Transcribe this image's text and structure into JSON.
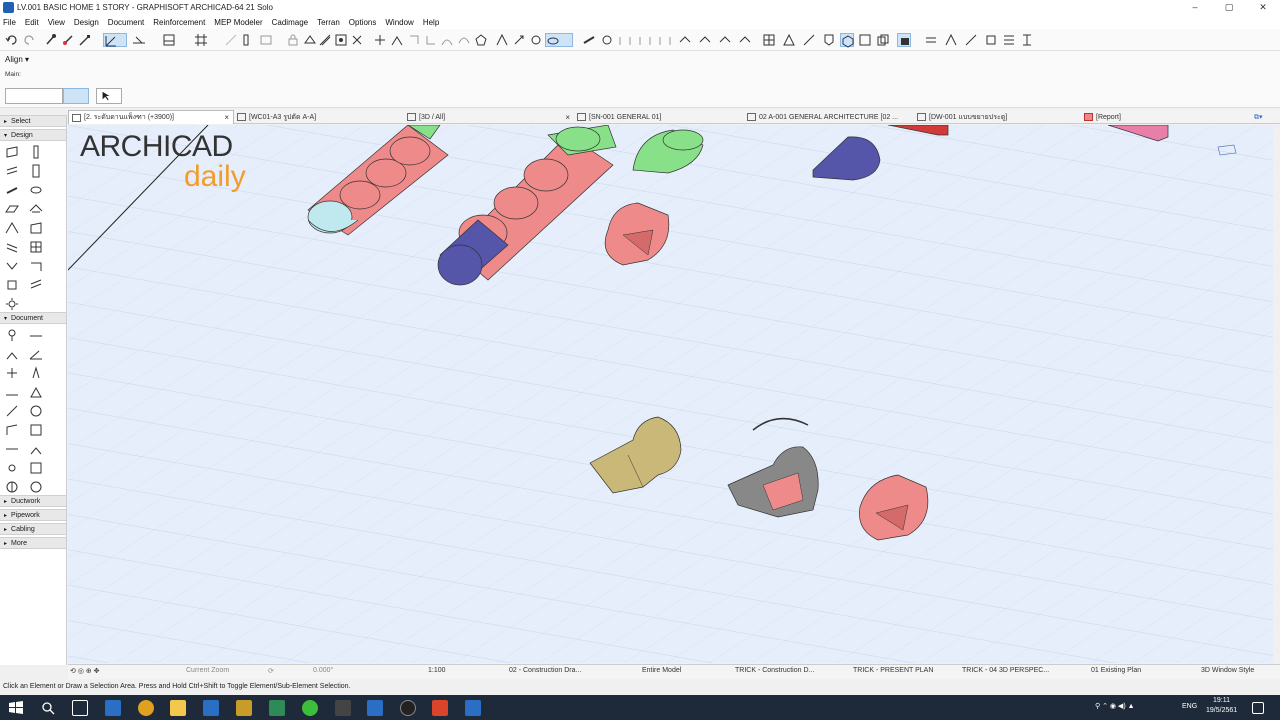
{
  "window": {
    "title": "LV.001 BASIC HOME 1 STORY - GRAPHISOFT ARCHICAD-64 21 Solo",
    "controls": [
      "–",
      "▢",
      "✕"
    ]
  },
  "menu": [
    "File",
    "Edit",
    "View",
    "Design",
    "Document",
    "Reinforcement",
    "MEP Modeler",
    "Cadimage",
    "Terran",
    "Options",
    "Window",
    "Help"
  ],
  "align_row": {
    "label": "Align",
    "sub_label": "Main:"
  },
  "tabs": [
    {
      "label": "[2. ระดับดานแพ็งฑา (+3900)]",
      "icon": "floorplan-icon",
      "active": true,
      "close": "×"
    },
    {
      "label": "[WC01-A3 รูปตัด A-A]",
      "icon": "section-icon",
      "active": false,
      "close": ""
    },
    {
      "label": "[3D / All]",
      "icon": "3d-icon",
      "active": false,
      "close": "×"
    },
    {
      "label": "[SN-001 GENERAL 01]",
      "icon": "layout-icon",
      "active": false,
      "close": ""
    },
    {
      "label": "02 A-001 GENERAL ARCHITECTURE [02 ...",
      "icon": "layout-icon",
      "active": false,
      "close": ""
    },
    {
      "label": "[DW-001 แบบขยายประตู]",
      "icon": "worksheet-icon",
      "active": false,
      "close": ""
    },
    {
      "label": "[Report]",
      "icon": "report-icon",
      "active": false,
      "close": ""
    }
  ],
  "toolbox": {
    "sections": [
      {
        "label": "Select",
        "expanded": false
      },
      {
        "label": "Design",
        "expanded": true
      },
      {
        "label": "Document",
        "expanded": true
      },
      {
        "label": "Ductwork",
        "expanded": false
      },
      {
        "label": "Pipework",
        "expanded": false
      },
      {
        "label": "Cabling",
        "expanded": false
      },
      {
        "label": "More",
        "expanded": false
      }
    ]
  },
  "logo": {
    "line1": "ARCHICAD",
    "line2": "daily"
  },
  "navbar": {
    "zoom_label": "Current Zoom",
    "angle": "0.000°",
    "scale": "1:100",
    "layer_combo": "02 - Construction Dra...",
    "model_view": "Entire Model",
    "pen_set": "TRICK - Construction D...",
    "model_view_option": "TRICK - PRESENT PLAN",
    "render_style": "TRICK - 04 3D PERSPEC...",
    "renovation": "01 Existing Plan",
    "window_style": "3D Window Style"
  },
  "status": "Click an Element or Draw a Selection Area. Press and Hold Ctrl+Shift to Toggle Element/Sub-Element Selection.",
  "tray": {
    "lang": "ENG",
    "time": "19:11",
    "date": "19/5/2561"
  },
  "colors": {
    "viewport_bg": "#e6eefb",
    "pink_fitting": "#ee8a8a",
    "green_fitting": "#88e088",
    "blue_fitting": "#5555aa",
    "cyan_fitting": "#bfe9ef",
    "tan_fitting": "#c9b877",
    "gray_fitting": "#888888",
    "logo_dark": "#333333",
    "logo_orange": "#f39c2b"
  }
}
